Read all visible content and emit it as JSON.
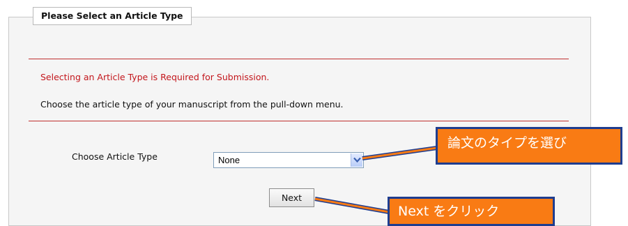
{
  "section": {
    "title": "Please Select an Article Type"
  },
  "messages": {
    "required": "Selecting an Article Type is Required for Submission.",
    "instruction": "Choose the article type of your manuscript from the pull-down menu."
  },
  "article_type": {
    "label": "Choose Article Type",
    "selected": "None"
  },
  "buttons": {
    "next": "Next"
  },
  "annotations": {
    "select_callout": "論文のタイプを選び",
    "next_callout": "Next をクリック"
  },
  "colors": {
    "error_text": "#c3161c",
    "divider": "#c0302f",
    "callout_fill": "#f97b14",
    "callout_border": "#1f3d8f"
  },
  "icons": {
    "dropdown": "chevron-down-icon"
  }
}
